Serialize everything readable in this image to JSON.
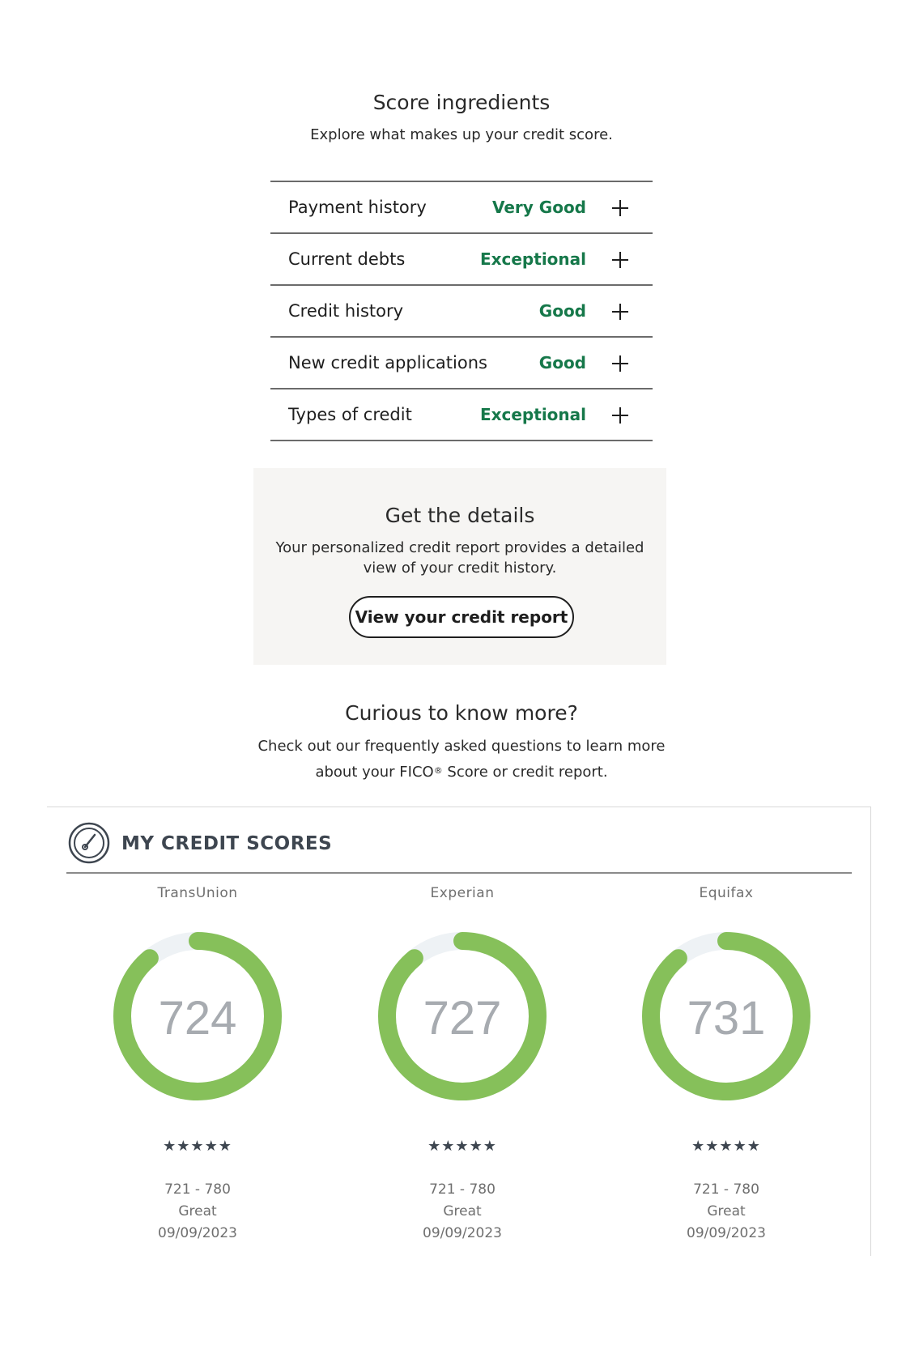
{
  "ingredients_section": {
    "title": "Score ingredients",
    "subtitle": "Explore what makes up your credit score.",
    "items": [
      {
        "label": "Payment history",
        "rating": "Very Good"
      },
      {
        "label": "Current debts",
        "rating": "Exceptional"
      },
      {
        "label": "Credit history",
        "rating": "Good"
      },
      {
        "label": "New credit applications",
        "rating": "Good"
      },
      {
        "label": "Types of credit",
        "rating": "Exceptional"
      }
    ],
    "expand_icon": "plus-icon",
    "rating_color": "#16784a"
  },
  "details": {
    "title": "Get the details",
    "text": "Your personalized credit report provides a detailed view of your credit history.",
    "button_label": "View your credit report",
    "background": "#f6f5f3"
  },
  "curious": {
    "title": "Curious to know more?",
    "line1": "Check out our frequently asked questions to learn more",
    "line2_a": "about your FICO",
    "line2_sup": "®",
    "line2_b": " Score or credit report."
  },
  "credit_scores": {
    "title": "MY CREDIT SCORES",
    "icon": "gauge-icon",
    "ring_color": "#86c05a",
    "ring_track_color": "#eef2f5",
    "score_max": 850,
    "bureaus": [
      {
        "name": "TransUnion",
        "score": "724",
        "fill_fraction": 0.89,
        "stars": "★★★★★",
        "range": "721 - 780",
        "label": "Great",
        "date": "09/09/2023"
      },
      {
        "name": "Experian",
        "score": "727",
        "fill_fraction": 0.89,
        "stars": "★★★★★",
        "range": "721 - 780",
        "label": "Great",
        "date": "09/09/2023"
      },
      {
        "name": "Equifax",
        "score": "731",
        "fill_fraction": 0.89,
        "stars": "★★★★★",
        "range": "721 - 780",
        "label": "Great",
        "date": "09/09/2023"
      }
    ]
  }
}
